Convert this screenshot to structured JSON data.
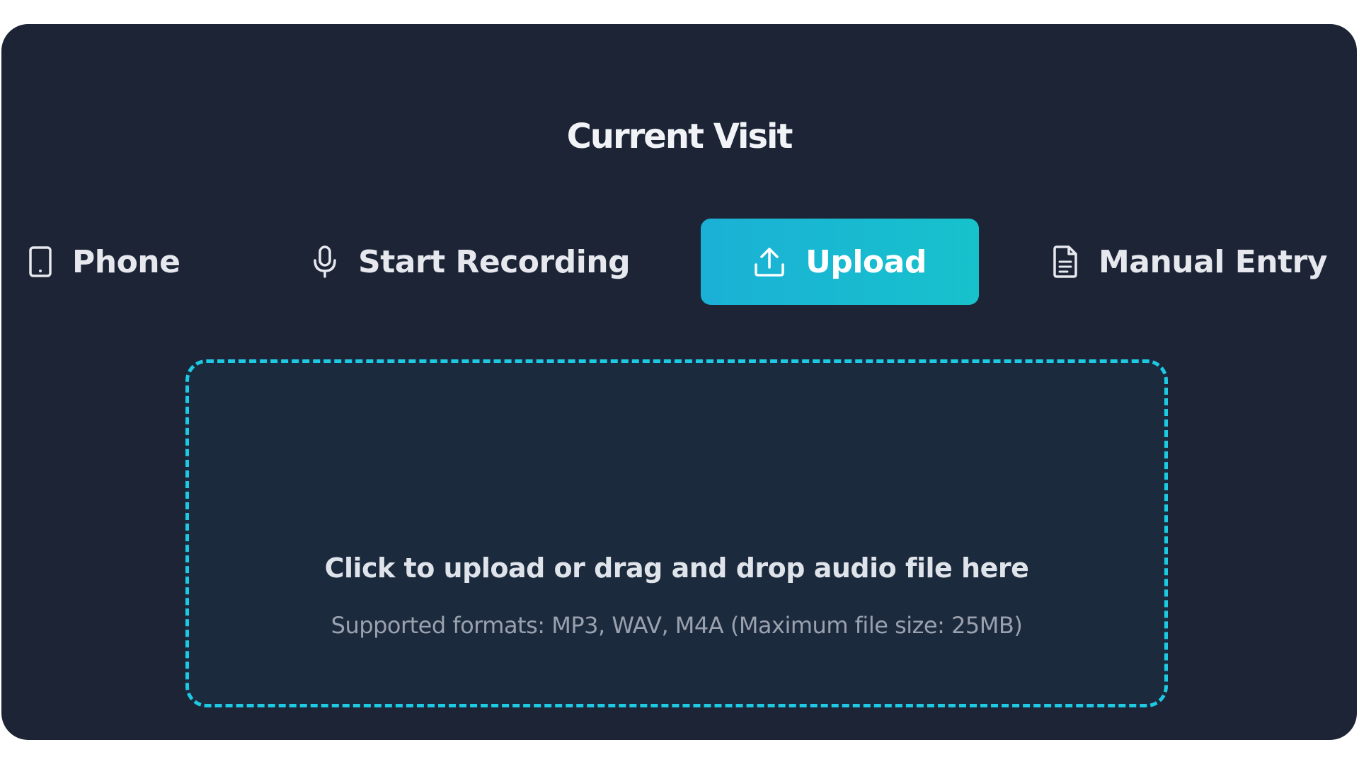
{
  "panel": {
    "title": "Current Visit"
  },
  "tabs": [
    {
      "label": "Phone",
      "icon": "phone-icon",
      "active": false
    },
    {
      "label": "Start Recording",
      "icon": "microphone-icon",
      "active": false
    },
    {
      "label": "Upload",
      "icon": "upload-icon",
      "active": true
    },
    {
      "label": "Manual Entry",
      "icon": "document-icon",
      "active": false
    }
  ],
  "dropzone": {
    "instruction": "Click to upload or drag and drop audio file here",
    "formats": "Supported formats: MP3, WAV, M4A (Maximum file size: 25MB)"
  },
  "colors": {
    "panel_bg": "#1c2436",
    "accent": "#1ec9e3",
    "active_tab": "#17bfd0"
  }
}
